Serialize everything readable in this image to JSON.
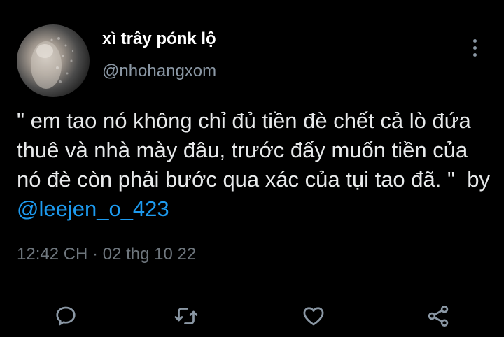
{
  "tweet": {
    "author_name": "xì trây pónk lộ",
    "author_handle": "@nhohangxom",
    "text": "\" em tao nó không chỉ đủ tiền đè chết cả lò đứa thuê và nhà mày đâu, trước đấy muốn tiền của nó đè còn phải bước qua xác của tụi tao đã. \"  by ",
    "mention": "@leejen_o_423",
    "timestamp": "12:42 CH · 02 thg 10 22"
  },
  "actions": {
    "reply_icon": "speech-bubble-icon",
    "retweet_icon": "retweet-icon",
    "like_icon": "heart-icon",
    "share_icon": "share-nodes-icon"
  },
  "colors": {
    "background": "#000000",
    "primary_text": "#e7e9ea",
    "secondary_text": "#8b98a5",
    "link": "#1d9bf0",
    "divider": "#2f3336"
  }
}
